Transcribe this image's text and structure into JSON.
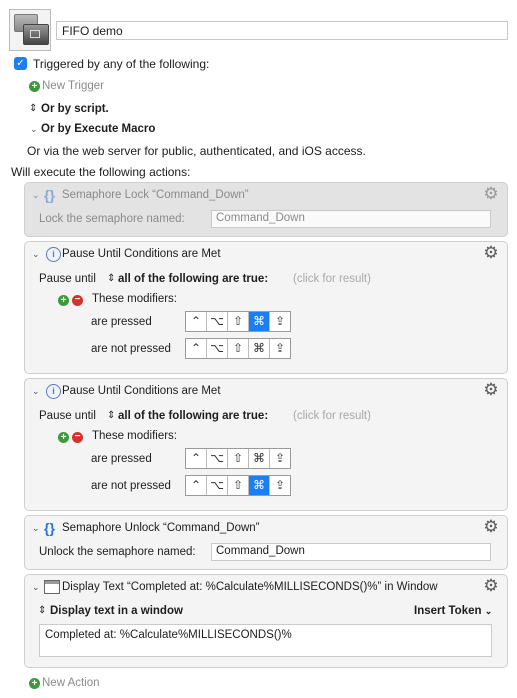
{
  "macro": {
    "name": "FIFO demo"
  },
  "trigger": {
    "checkbox_label": "Triggered by any of the following:",
    "checked": true,
    "new_trigger": "New Trigger",
    "or_by_script": "Or by script.",
    "or_by_execute_macro": "Or by Execute Macro",
    "web_server_note": "Or via the web server for public, authenticated, and iOS access."
  },
  "actions_header": "Will execute the following actions:",
  "actions": [
    {
      "title": "Semaphore Lock “Command_Down”",
      "field_label": "Lock the semaphore named:",
      "field_value": "Command_Down",
      "disabled": true
    },
    {
      "title": "Pause Until Conditions are Met",
      "pause_label": "Pause until",
      "condition_selector": "all of the following are true:",
      "result_hint": "(click for result)",
      "modifiers_label": "These modifiers:",
      "rows": [
        {
          "label": "are pressed",
          "keys": [
            "⌃",
            "⌥",
            "⇧",
            "⌘",
            "⇪"
          ],
          "active": [
            false,
            false,
            false,
            true,
            false
          ]
        },
        {
          "label": "are not pressed",
          "keys": [
            "⌃",
            "⌥",
            "⇧",
            "⌘",
            "⇪"
          ],
          "active": [
            false,
            false,
            false,
            false,
            false
          ]
        }
      ]
    },
    {
      "title": "Pause Until Conditions are Met",
      "pause_label": "Pause until",
      "condition_selector": "all of the following are true:",
      "result_hint": "(click for result)",
      "modifiers_label": "These modifiers:",
      "rows": [
        {
          "label": "are pressed",
          "keys": [
            "⌃",
            "⌥",
            "⇧",
            "⌘",
            "⇪"
          ],
          "active": [
            false,
            false,
            false,
            false,
            false
          ]
        },
        {
          "label": "are not pressed",
          "keys": [
            "⌃",
            "⌥",
            "⇧",
            "⌘",
            "⇪"
          ],
          "active": [
            false,
            false,
            false,
            true,
            false
          ]
        }
      ]
    },
    {
      "title": "Semaphore Unlock “Command_Down”",
      "field_label": "Unlock the semaphore named:",
      "field_value": "Command_Down"
    },
    {
      "title": "Display Text “Completed at: %Calculate%MILLISECONDS()%” in Window",
      "mode": "Display text in a window",
      "insert_token": "Insert Token",
      "text": "Completed at: %Calculate%MILLISECONDS()%"
    }
  ],
  "new_action": "New Action",
  "icons": {
    "collapse": "chevron-down-icon",
    "gear": "gear-icon",
    "semaphore": "semaphore-icon",
    "pause": "info-icon",
    "display": "window-icon",
    "add": "plus-icon",
    "remove": "minus-icon"
  },
  "colors": {
    "accent": "#1a7ef5",
    "add": "#3a9b38",
    "remove": "#d5322a"
  }
}
